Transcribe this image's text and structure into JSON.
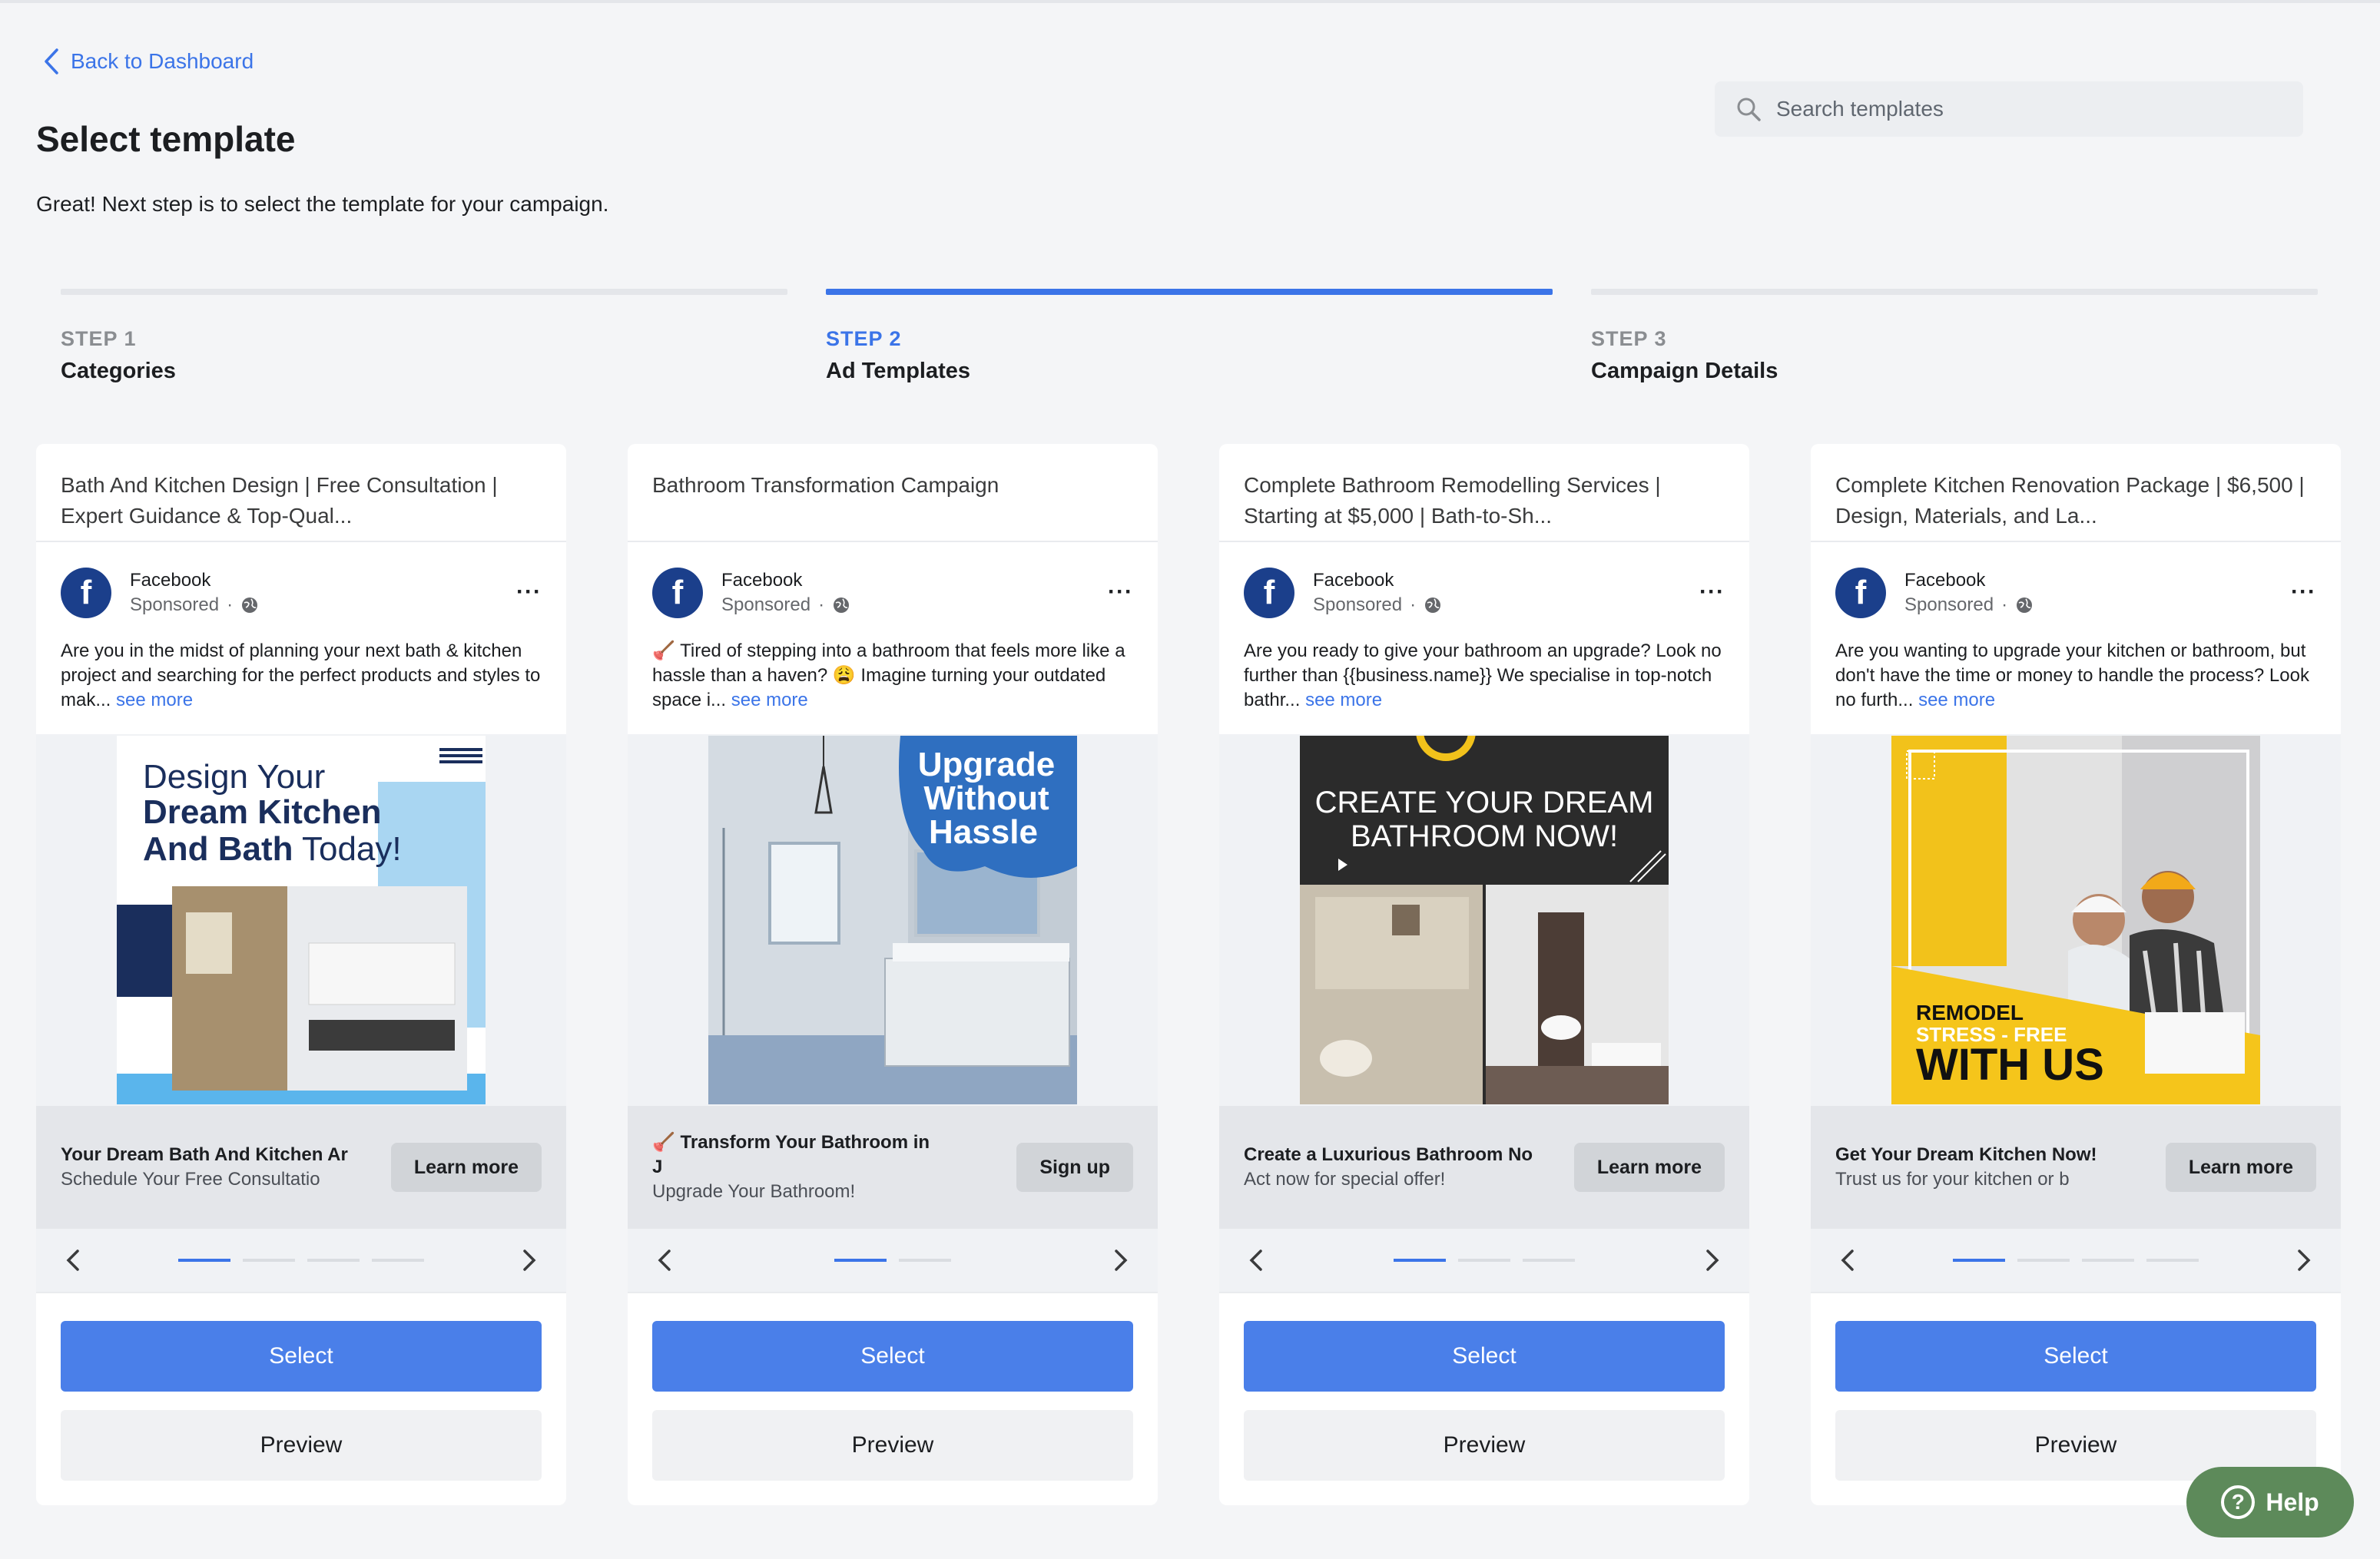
{
  "nav": {
    "back_label": "Back to Dashboard"
  },
  "header": {
    "title": "Select template",
    "subtitle": "Great! Next step is to select the template for your campaign."
  },
  "search": {
    "placeholder": "Search templates"
  },
  "steps": [
    {
      "number": "STEP 1",
      "name": "Categories",
      "active": false
    },
    {
      "number": "STEP 2",
      "name": "Ad Templates",
      "active": true
    },
    {
      "number": "STEP 3",
      "name": "Campaign Details",
      "active": false
    }
  ],
  "cards": [
    {
      "title": "Bath And Kitchen Design | Free Consultation | Expert Guidance & Top-Qual...",
      "page_name": "Facebook",
      "sponsored": "Sponsored",
      "body": "Are you in the midst of planning your next bath & kitchen project and searching for the perfect products and styles to mak...",
      "see_more": "see more",
      "image_text": [
        "Design Your",
        "Dream Kitchen",
        "And Bath",
        "Today!"
      ],
      "headline": "Your Dream Bath And Kitchen Ar",
      "description": "Schedule Your Free Consultatio",
      "cta": "Learn more",
      "slides": 4,
      "select": "Select",
      "preview": "Preview"
    },
    {
      "title": "Bathroom Transformation Campaign",
      "page_name": "Facebook",
      "sponsored": "Sponsored",
      "body": "🪠 Tired of stepping into a bathroom that feels more like a hassle than a haven? 😩 Imagine turning your outdated space i...",
      "see_more": "see more",
      "image_text": [
        "Upgrade",
        "Without",
        "Hassle"
      ],
      "headline": "🪠 Transform Your Bathroom in J",
      "description": "Upgrade Your Bathroom!",
      "cta": "Sign up",
      "slides": 2,
      "select": "Select",
      "preview": "Preview"
    },
    {
      "title": "Complete Bathroom Remodelling Services | Starting at $5,000 | Bath-to-Sh...",
      "page_name": "Facebook",
      "sponsored": "Sponsored",
      "body": "Are you ready to give your bathroom an upgrade? Look no further than {{business.name}} We specialise in top-notch bathr...",
      "see_more": "see more",
      "image_text": [
        "CREATE YOUR DREAM",
        "BATHROOM NOW!"
      ],
      "headline": "Create a Luxurious Bathroom No",
      "description": "Act now for special offer!",
      "cta": "Learn more",
      "slides": 3,
      "select": "Select",
      "preview": "Preview"
    },
    {
      "title": "Complete Kitchen Renovation Package | $6,500 | Design, Materials, and La...",
      "page_name": "Facebook",
      "sponsored": "Sponsored",
      "body": "Are you wanting to upgrade your kitchen or bathroom, but don't have the time or money to handle the process? Look no furth...",
      "see_more": "see more",
      "image_text": [
        "REMODEL",
        "STRESS - FREE",
        "WITH US"
      ],
      "headline": "Get Your Dream Kitchen Now!",
      "description": "Trust us for your kitchen or b",
      "cta": "Learn more",
      "slides": 4,
      "select": "Select",
      "preview": "Preview"
    }
  ],
  "help": {
    "label": "Help"
  },
  "colors": {
    "accent": "#3b74e8",
    "select_button": "#4a7fe9",
    "help_button": "#5d8a5a",
    "facebook": "#1b3f8b"
  }
}
